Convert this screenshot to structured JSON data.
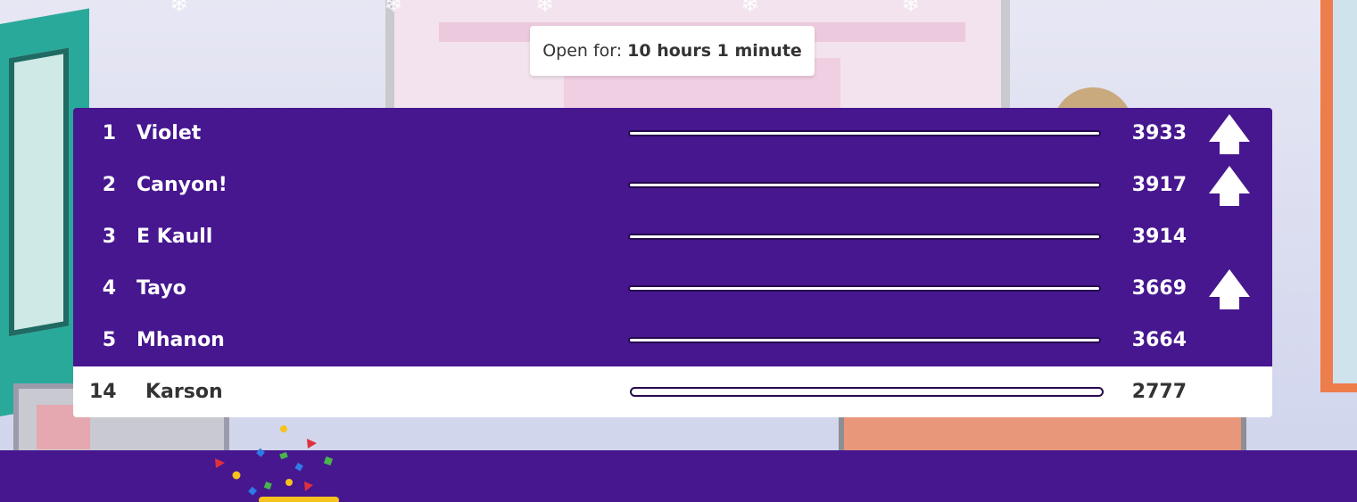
{
  "timer": {
    "prefix": "Open for:",
    "value": "10 hours 1 minute"
  },
  "leaderboard": {
    "rows": [
      {
        "rank": "1",
        "name": "Violet",
        "score": "3933",
        "trend": "up",
        "progress": 1.0
      },
      {
        "rank": "2",
        "name": "Canyon!",
        "score": "3917",
        "trend": "up",
        "progress": 1.0
      },
      {
        "rank": "3",
        "name": "E Kaull",
        "score": "3914",
        "trend": "none",
        "progress": 1.0
      },
      {
        "rank": "4",
        "name": "Tayo",
        "score": "3669",
        "trend": "up",
        "progress": 1.0
      },
      {
        "rank": "5",
        "name": "Mhanon",
        "score": "3664",
        "trend": "none",
        "progress": 1.0
      }
    ],
    "self": {
      "rank": "14",
      "name": "Karson",
      "score": "2777",
      "trend": "none",
      "progress": 1.0
    }
  },
  "colors": {
    "primary": "#46178f",
    "bar_outline": "#26084d",
    "self_row": "#ffffff",
    "text_dark": "#333333"
  },
  "icons": {
    "trend_up": "arrow-up-icon",
    "decoration": "confetti-icon"
  }
}
